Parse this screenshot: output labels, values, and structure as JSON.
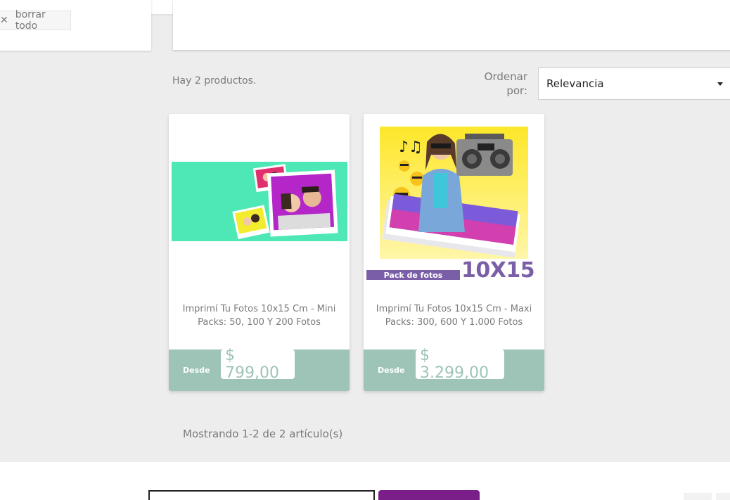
{
  "filters": {
    "clear_label": "borrar todo",
    "clear_icon": "close-icon"
  },
  "listing": {
    "count_text": "Hay 2 productos.",
    "sort_label_line1": "Ordenar",
    "sort_label_line2": "por:",
    "sort_value": "Relevancia",
    "pagination_text": "Mostrando 1-2 de 2 artículo(s)"
  },
  "products": [
    {
      "title_line1": "Imprimí Tu Fotos 10x15 Cm - Mini",
      "title_line2": "Packs: 50, 100 Y 200 Fotos",
      "price_prefix": "Desde",
      "price": "$ 799,00"
    },
    {
      "title_line1": "Imprimí Tu Fotos 10x15 Cm - Maxi",
      "title_line2": "Packs: 300, 600 Y 1.000 Fotos",
      "price_prefix": "Desde",
      "price": "$ 3.299,00",
      "banner_tag": "Pack de fotos",
      "banner_size": "10X15"
    }
  ],
  "colors": {
    "price_bar": "#9dc4b7",
    "accent_purple": "#7a5fa8",
    "newsletter_button": "#7a1e8a",
    "mint_background": "#4de8b6"
  }
}
